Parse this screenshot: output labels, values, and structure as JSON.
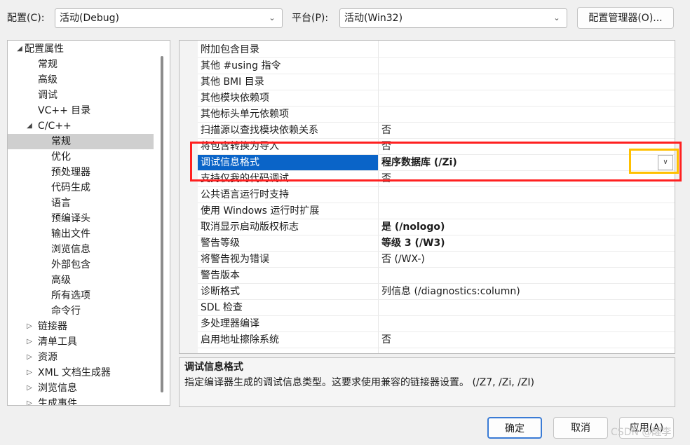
{
  "header": {
    "config_label": "配置(C):",
    "config_value": "活动(Debug)",
    "platform_label": "平台(P):",
    "platform_value": "活动(Win32)",
    "config_manager_label": "配置管理器(O)..."
  },
  "tree": {
    "items": [
      {
        "label": "配置属性",
        "toggle": "◢",
        "level": 0
      },
      {
        "label": "常规",
        "toggle": "",
        "level": 1
      },
      {
        "label": "高级",
        "toggle": "",
        "level": 1
      },
      {
        "label": "调试",
        "toggle": "",
        "level": 1
      },
      {
        "label": "VC++ 目录",
        "toggle": "",
        "level": 1
      },
      {
        "label": "C/C++",
        "toggle": "◢",
        "level": 1
      },
      {
        "label": "常规",
        "toggle": "",
        "level": 2,
        "selected": true
      },
      {
        "label": "优化",
        "toggle": "",
        "level": 2
      },
      {
        "label": "预处理器",
        "toggle": "",
        "level": 2
      },
      {
        "label": "代码生成",
        "toggle": "",
        "level": 2
      },
      {
        "label": "语言",
        "toggle": "",
        "level": 2
      },
      {
        "label": "预编译头",
        "toggle": "",
        "level": 2
      },
      {
        "label": "输出文件",
        "toggle": "",
        "level": 2
      },
      {
        "label": "浏览信息",
        "toggle": "",
        "level": 2
      },
      {
        "label": "外部包含",
        "toggle": "",
        "level": 2
      },
      {
        "label": "高级",
        "toggle": "",
        "level": 2
      },
      {
        "label": "所有选项",
        "toggle": "",
        "level": 2
      },
      {
        "label": "命令行",
        "toggle": "",
        "level": 2
      },
      {
        "label": "链接器",
        "toggle": "▷",
        "level": 1
      },
      {
        "label": "清单工具",
        "toggle": "▷",
        "level": 1
      },
      {
        "label": "资源",
        "toggle": "▷",
        "level": 1
      },
      {
        "label": "XML 文档生成器",
        "toggle": "▷",
        "level": 1
      },
      {
        "label": "浏览信息",
        "toggle": "▷",
        "level": 1
      },
      {
        "label": "生成事件",
        "toggle": "▷",
        "level": 1
      }
    ]
  },
  "properties": {
    "rows": [
      {
        "name": "附加包含目录",
        "value": "",
        "bold": false
      },
      {
        "name": "其他 #using 指令",
        "value": "",
        "bold": false
      },
      {
        "name": "其他 BMI 目录",
        "value": "",
        "bold": false
      },
      {
        "name": "其他模块依赖项",
        "value": "",
        "bold": false
      },
      {
        "name": "其他标头单元依赖项",
        "value": "",
        "bold": false
      },
      {
        "name": "扫描源以查找模块依赖关系",
        "value": "否",
        "bold": false
      },
      {
        "name": "将包含转换为导入",
        "value": "否",
        "bold": false
      },
      {
        "name": "调试信息格式",
        "value": "程序数据库 (/Zi)",
        "bold": true,
        "selected": true
      },
      {
        "name": "支持仅我的代码调试",
        "value": "否",
        "bold": false
      },
      {
        "name": "公共语言运行时支持",
        "value": "",
        "bold": false
      },
      {
        "name": "使用 Windows 运行时扩展",
        "value": "",
        "bold": false
      },
      {
        "name": "取消显示启动版权标志",
        "value": "是 (/nologo)",
        "bold": true
      },
      {
        "name": "警告等级",
        "value": "等级 3 (/W3)",
        "bold": true
      },
      {
        "name": "将警告视为错误",
        "value": "否 (/WX-)",
        "bold": false
      },
      {
        "name": "警告版本",
        "value": "",
        "bold": false
      },
      {
        "name": "诊断格式",
        "value": "列信息 (/diagnostics:column)",
        "bold": false
      },
      {
        "name": "SDL 检查",
        "value": "",
        "bold": false
      },
      {
        "name": "多处理器编译",
        "value": "",
        "bold": false
      },
      {
        "name": "启用地址擦除系统",
        "value": "否",
        "bold": false
      }
    ]
  },
  "description": {
    "title": "调试信息格式",
    "body": "指定编译器生成的调试信息类型。这要求使用兼容的链接器设置。  (/Z7, /Zi, /ZI)"
  },
  "footer": {
    "ok_label": "确定",
    "cancel_label": "取消",
    "apply_label": "应用(A)"
  },
  "watermark": "CSDN @醒李",
  "icons": {
    "dropdown": "chevron-down-icon",
    "expanded": "triangle-expanded-icon",
    "collapsed": "triangle-collapsed-icon"
  },
  "colors": {
    "selection": "#0a64c8",
    "highlight_red": "#ff2020",
    "highlight_yellow": "#ffc000"
  }
}
